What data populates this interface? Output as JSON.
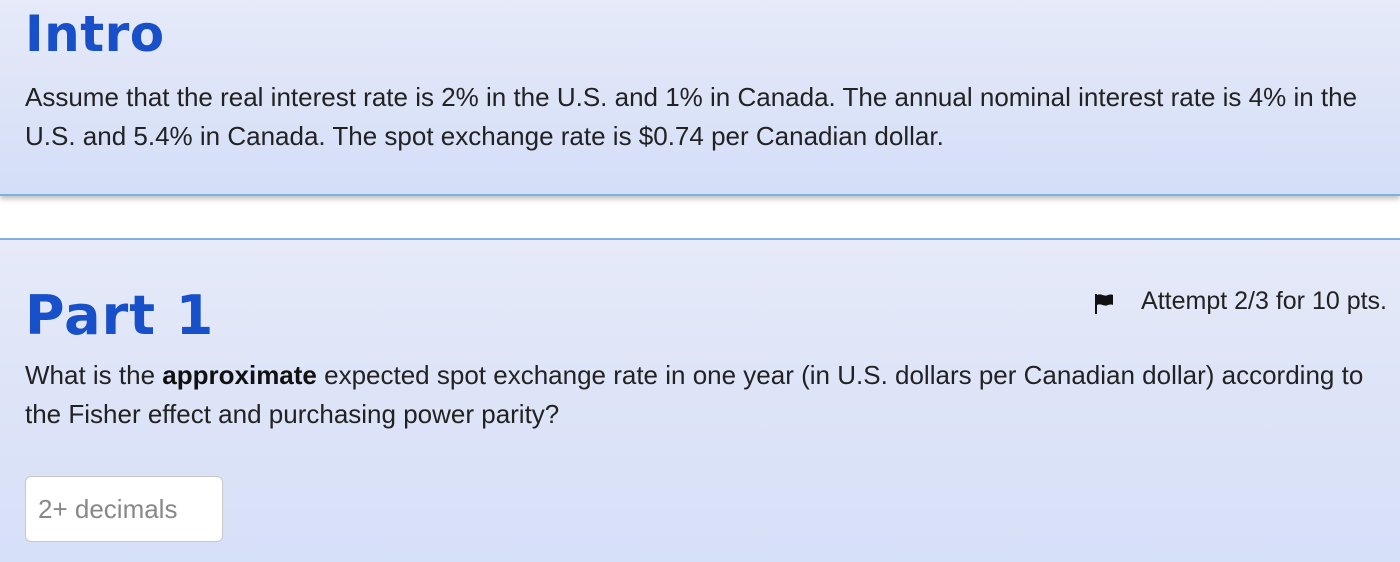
{
  "intro": {
    "title": "Intro",
    "text": "Assume that the real interest rate is 2% in the U.S. and 1% in Canada. The annual nominal interest rate is 4% in the U.S. and 5.4% in Canada. The spot exchange rate is $0.74 per Canadian dollar."
  },
  "part1": {
    "title": "Part 1",
    "flag_icon": "flag-icon",
    "attempt_text": "Attempt 2/3 for 10 pts.",
    "question_prefix": "What is the ",
    "question_bold": "approximate",
    "question_suffix": " expected spot exchange rate in one year (in U.S. dollars per Canadian dollar) according to the Fisher effect and purchasing power parity?",
    "answer": {
      "value": "",
      "placeholder": "2+ decimals"
    }
  },
  "colors": {
    "heading_blue": "#1750c8",
    "card_border": "#7fb2de",
    "card_background": "#dde4f8"
  }
}
